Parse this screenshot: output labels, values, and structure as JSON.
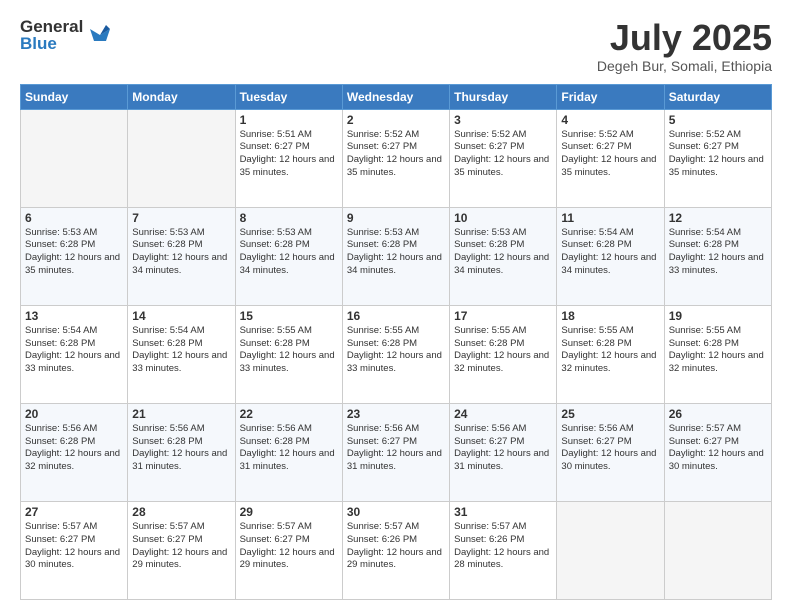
{
  "logo": {
    "general": "General",
    "blue": "Blue"
  },
  "title": "July 2025",
  "location": "Degeh Bur, Somali, Ethiopia",
  "days_of_week": [
    "Sunday",
    "Monday",
    "Tuesday",
    "Wednesday",
    "Thursday",
    "Friday",
    "Saturday"
  ],
  "weeks": [
    {
      "row_class": "row-odd",
      "days": [
        {
          "num": "",
          "empty": true
        },
        {
          "num": "",
          "empty": true
        },
        {
          "num": "1",
          "sunrise": "Sunrise: 5:51 AM",
          "sunset": "Sunset: 6:27 PM",
          "daylight": "Daylight: 12 hours and 35 minutes."
        },
        {
          "num": "2",
          "sunrise": "Sunrise: 5:52 AM",
          "sunset": "Sunset: 6:27 PM",
          "daylight": "Daylight: 12 hours and 35 minutes."
        },
        {
          "num": "3",
          "sunrise": "Sunrise: 5:52 AM",
          "sunset": "Sunset: 6:27 PM",
          "daylight": "Daylight: 12 hours and 35 minutes."
        },
        {
          "num": "4",
          "sunrise": "Sunrise: 5:52 AM",
          "sunset": "Sunset: 6:27 PM",
          "daylight": "Daylight: 12 hours and 35 minutes."
        },
        {
          "num": "5",
          "sunrise": "Sunrise: 5:52 AM",
          "sunset": "Sunset: 6:27 PM",
          "daylight": "Daylight: 12 hours and 35 minutes."
        }
      ]
    },
    {
      "row_class": "row-even",
      "days": [
        {
          "num": "6",
          "sunrise": "Sunrise: 5:53 AM",
          "sunset": "Sunset: 6:28 PM",
          "daylight": "Daylight: 12 hours and 35 minutes."
        },
        {
          "num": "7",
          "sunrise": "Sunrise: 5:53 AM",
          "sunset": "Sunset: 6:28 PM",
          "daylight": "Daylight: 12 hours and 34 minutes."
        },
        {
          "num": "8",
          "sunrise": "Sunrise: 5:53 AM",
          "sunset": "Sunset: 6:28 PM",
          "daylight": "Daylight: 12 hours and 34 minutes."
        },
        {
          "num": "9",
          "sunrise": "Sunrise: 5:53 AM",
          "sunset": "Sunset: 6:28 PM",
          "daylight": "Daylight: 12 hours and 34 minutes."
        },
        {
          "num": "10",
          "sunrise": "Sunrise: 5:53 AM",
          "sunset": "Sunset: 6:28 PM",
          "daylight": "Daylight: 12 hours and 34 minutes."
        },
        {
          "num": "11",
          "sunrise": "Sunrise: 5:54 AM",
          "sunset": "Sunset: 6:28 PM",
          "daylight": "Daylight: 12 hours and 34 minutes."
        },
        {
          "num": "12",
          "sunrise": "Sunrise: 5:54 AM",
          "sunset": "Sunset: 6:28 PM",
          "daylight": "Daylight: 12 hours and 33 minutes."
        }
      ]
    },
    {
      "row_class": "row-odd",
      "days": [
        {
          "num": "13",
          "sunrise": "Sunrise: 5:54 AM",
          "sunset": "Sunset: 6:28 PM",
          "daylight": "Daylight: 12 hours and 33 minutes."
        },
        {
          "num": "14",
          "sunrise": "Sunrise: 5:54 AM",
          "sunset": "Sunset: 6:28 PM",
          "daylight": "Daylight: 12 hours and 33 minutes."
        },
        {
          "num": "15",
          "sunrise": "Sunrise: 5:55 AM",
          "sunset": "Sunset: 6:28 PM",
          "daylight": "Daylight: 12 hours and 33 minutes."
        },
        {
          "num": "16",
          "sunrise": "Sunrise: 5:55 AM",
          "sunset": "Sunset: 6:28 PM",
          "daylight": "Daylight: 12 hours and 33 minutes."
        },
        {
          "num": "17",
          "sunrise": "Sunrise: 5:55 AM",
          "sunset": "Sunset: 6:28 PM",
          "daylight": "Daylight: 12 hours and 32 minutes."
        },
        {
          "num": "18",
          "sunrise": "Sunrise: 5:55 AM",
          "sunset": "Sunset: 6:28 PM",
          "daylight": "Daylight: 12 hours and 32 minutes."
        },
        {
          "num": "19",
          "sunrise": "Sunrise: 5:55 AM",
          "sunset": "Sunset: 6:28 PM",
          "daylight": "Daylight: 12 hours and 32 minutes."
        }
      ]
    },
    {
      "row_class": "row-even",
      "days": [
        {
          "num": "20",
          "sunrise": "Sunrise: 5:56 AM",
          "sunset": "Sunset: 6:28 PM",
          "daylight": "Daylight: 12 hours and 32 minutes."
        },
        {
          "num": "21",
          "sunrise": "Sunrise: 5:56 AM",
          "sunset": "Sunset: 6:28 PM",
          "daylight": "Daylight: 12 hours and 31 minutes."
        },
        {
          "num": "22",
          "sunrise": "Sunrise: 5:56 AM",
          "sunset": "Sunset: 6:28 PM",
          "daylight": "Daylight: 12 hours and 31 minutes."
        },
        {
          "num": "23",
          "sunrise": "Sunrise: 5:56 AM",
          "sunset": "Sunset: 6:27 PM",
          "daylight": "Daylight: 12 hours and 31 minutes."
        },
        {
          "num": "24",
          "sunrise": "Sunrise: 5:56 AM",
          "sunset": "Sunset: 6:27 PM",
          "daylight": "Daylight: 12 hours and 31 minutes."
        },
        {
          "num": "25",
          "sunrise": "Sunrise: 5:56 AM",
          "sunset": "Sunset: 6:27 PM",
          "daylight": "Daylight: 12 hours and 30 minutes."
        },
        {
          "num": "26",
          "sunrise": "Sunrise: 5:57 AM",
          "sunset": "Sunset: 6:27 PM",
          "daylight": "Daylight: 12 hours and 30 minutes."
        }
      ]
    },
    {
      "row_class": "row-odd",
      "days": [
        {
          "num": "27",
          "sunrise": "Sunrise: 5:57 AM",
          "sunset": "Sunset: 6:27 PM",
          "daylight": "Daylight: 12 hours and 30 minutes."
        },
        {
          "num": "28",
          "sunrise": "Sunrise: 5:57 AM",
          "sunset": "Sunset: 6:27 PM",
          "daylight": "Daylight: 12 hours and 29 minutes."
        },
        {
          "num": "29",
          "sunrise": "Sunrise: 5:57 AM",
          "sunset": "Sunset: 6:27 PM",
          "daylight": "Daylight: 12 hours and 29 minutes."
        },
        {
          "num": "30",
          "sunrise": "Sunrise: 5:57 AM",
          "sunset": "Sunset: 6:26 PM",
          "daylight": "Daylight: 12 hours and 29 minutes."
        },
        {
          "num": "31",
          "sunrise": "Sunrise: 5:57 AM",
          "sunset": "Sunset: 6:26 PM",
          "daylight": "Daylight: 12 hours and 28 minutes."
        },
        {
          "num": "",
          "empty": true
        },
        {
          "num": "",
          "empty": true
        }
      ]
    }
  ]
}
